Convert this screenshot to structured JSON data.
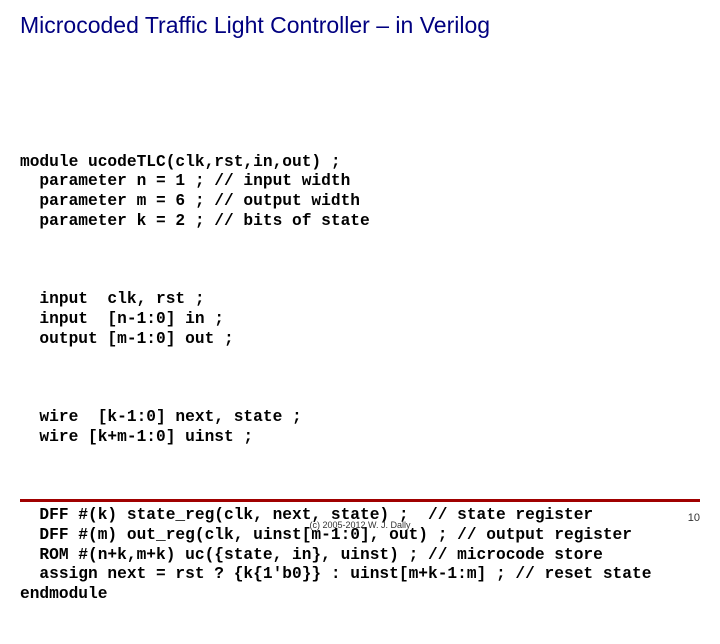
{
  "title": "Microcoded Traffic Light Controller – in Verilog",
  "code": {
    "p1": "module ucodeTLC(clk,rst,in,out) ;\n  parameter n = 1 ; // input width\n  parameter m = 6 ; // output width\n  parameter k = 2 ; // bits of state",
    "p2": "  input  clk, rst ;\n  input  [n-1:0] in ;\n  output [m-1:0] out ;",
    "p3": "  wire  [k-1:0] next, state ;\n  wire [k+m-1:0] uinst ;",
    "p4": "  DFF #(k) state_reg(clk, next, state) ;  // state register\n  DFF #(m) out_reg(clk, uinst[m-1:0], out) ; // output register\n  ROM #(n+k,m+k) uc({state, in}, uinst) ; // microcode store\n  assign next = rst ? {k{1'b0}} : uinst[m+k-1:m] ; // reset state\nendmodule"
  },
  "footer": {
    "copyright": "(c) 2005-2012 W. J. Dally",
    "page": "10"
  }
}
